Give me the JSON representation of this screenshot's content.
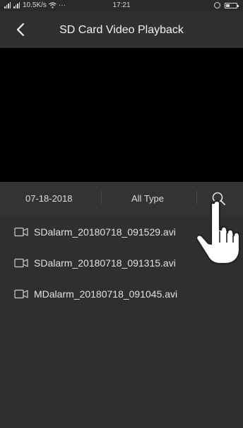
{
  "status_bar": {
    "left_text": "10.5K/s",
    "more": "···",
    "time": "17:21",
    "battery_level": 0.35
  },
  "header": {
    "back_icon": "chevron-left-icon",
    "title": "SD Card Video Playback"
  },
  "filters": {
    "date": "07-18-2018",
    "type": "All Type",
    "search_icon": "search-icon"
  },
  "files": [
    {
      "name": "SDalarm_20180718_091529.avi",
      "icon": "video-camera-icon"
    },
    {
      "name": "SDalarm_20180718_091315.avi",
      "icon": "video-camera-icon"
    },
    {
      "name": "MDalarm_20180718_091045.avi",
      "icon": "video-camera-icon"
    }
  ],
  "colors": {
    "background": "#2f2f2f",
    "video_area": "#000000",
    "text": "#e2e2e2"
  }
}
